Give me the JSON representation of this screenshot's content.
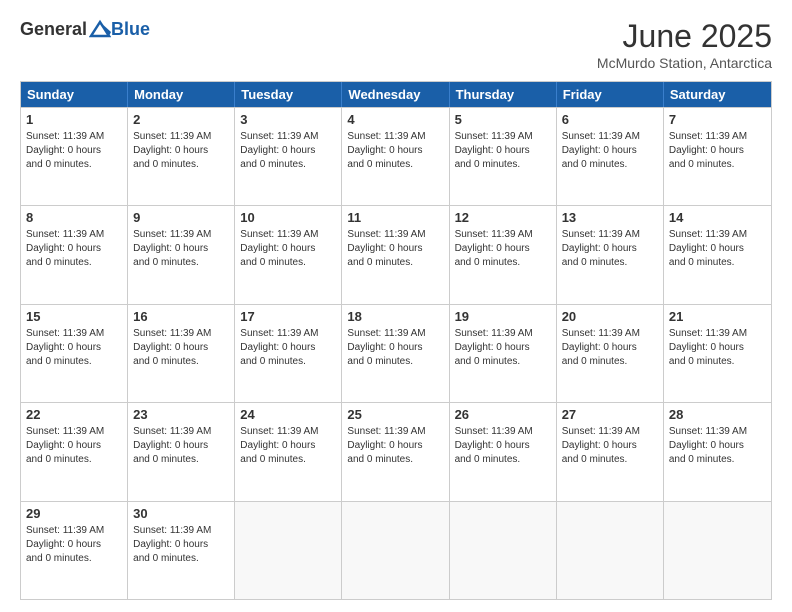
{
  "logo": {
    "text_general": "General",
    "text_blue": "Blue"
  },
  "title": "June 2025",
  "location": "McMurdo Station, Antarctica",
  "days_header": [
    "Sunday",
    "Monday",
    "Tuesday",
    "Wednesday",
    "Thursday",
    "Friday",
    "Saturday"
  ],
  "cell_info": "Sunset: 11:39 AM\nDaylight: 0 hours and 0 minutes.",
  "weeks": [
    [
      {
        "day": "1",
        "empty": false
      },
      {
        "day": "2",
        "empty": false
      },
      {
        "day": "3",
        "empty": false
      },
      {
        "day": "4",
        "empty": false
      },
      {
        "day": "5",
        "empty": false
      },
      {
        "day": "6",
        "empty": false
      },
      {
        "day": "7",
        "empty": false
      }
    ],
    [
      {
        "day": "8",
        "empty": false
      },
      {
        "day": "9",
        "empty": false
      },
      {
        "day": "10",
        "empty": false
      },
      {
        "day": "11",
        "empty": false
      },
      {
        "day": "12",
        "empty": false
      },
      {
        "day": "13",
        "empty": false
      },
      {
        "day": "14",
        "empty": false
      }
    ],
    [
      {
        "day": "15",
        "empty": false
      },
      {
        "day": "16",
        "empty": false
      },
      {
        "day": "17",
        "empty": false
      },
      {
        "day": "18",
        "empty": false
      },
      {
        "day": "19",
        "empty": false
      },
      {
        "day": "20",
        "empty": false
      },
      {
        "day": "21",
        "empty": false
      }
    ],
    [
      {
        "day": "22",
        "empty": false
      },
      {
        "day": "23",
        "empty": false
      },
      {
        "day": "24",
        "empty": false
      },
      {
        "day": "25",
        "empty": false
      },
      {
        "day": "26",
        "empty": false
      },
      {
        "day": "27",
        "empty": false
      },
      {
        "day": "28",
        "empty": false
      }
    ],
    [
      {
        "day": "29",
        "empty": false
      },
      {
        "day": "30",
        "empty": false
      },
      {
        "day": "",
        "empty": true
      },
      {
        "day": "",
        "empty": true
      },
      {
        "day": "",
        "empty": true
      },
      {
        "day": "",
        "empty": true
      },
      {
        "day": "",
        "empty": true
      }
    ]
  ]
}
